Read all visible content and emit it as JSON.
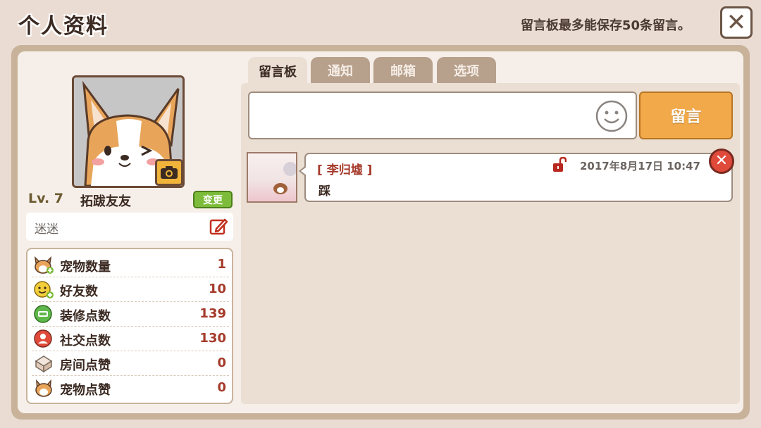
{
  "header": {
    "title": "个人资料",
    "notice": "留言板最多能保存50条留言。",
    "close_icon": "close-icon"
  },
  "profile": {
    "level": "Lv. 7",
    "username": "拓跋友友",
    "change_label": "变更",
    "signature": "迷迷",
    "avatar_icon": "corgi-avatar",
    "camera_icon": "camera-icon",
    "edit_icon": "edit-icon"
  },
  "stats": [
    {
      "icon": "pet-icon",
      "label": "宠物数量",
      "value": "1"
    },
    {
      "icon": "friend-icon",
      "label": "好友数",
      "value": "10"
    },
    {
      "icon": "decoration-icon",
      "label": "装修点数",
      "value": "139"
    },
    {
      "icon": "social-icon",
      "label": "社交点数",
      "value": "130"
    },
    {
      "icon": "room-like-icon",
      "label": "房间点赞",
      "value": "0"
    },
    {
      "icon": "pet-like-icon",
      "label": "宠物点赞",
      "value": "0"
    }
  ],
  "tabs": [
    {
      "label": "留言板",
      "active": true
    },
    {
      "label": "通知",
      "active": false
    },
    {
      "label": "邮箱",
      "active": false
    },
    {
      "label": "选项",
      "active": false
    }
  ],
  "board": {
    "input_placeholder": "",
    "emoji_icon": "smiley-icon",
    "post_label": "留言",
    "messages": [
      {
        "author": "[ 李归墟 ]",
        "text": "踩",
        "time": "2017年8月17日 10:47",
        "lock_icon": "unlocked-lock-icon",
        "delete_icon": "delete-icon"
      }
    ]
  },
  "colors": {
    "background": "#eadcd3",
    "frame": "#c8b39a",
    "accent_orange": "#f2a94a",
    "accent_green": "#7cbc3a",
    "value_red": "#a53a2a"
  }
}
